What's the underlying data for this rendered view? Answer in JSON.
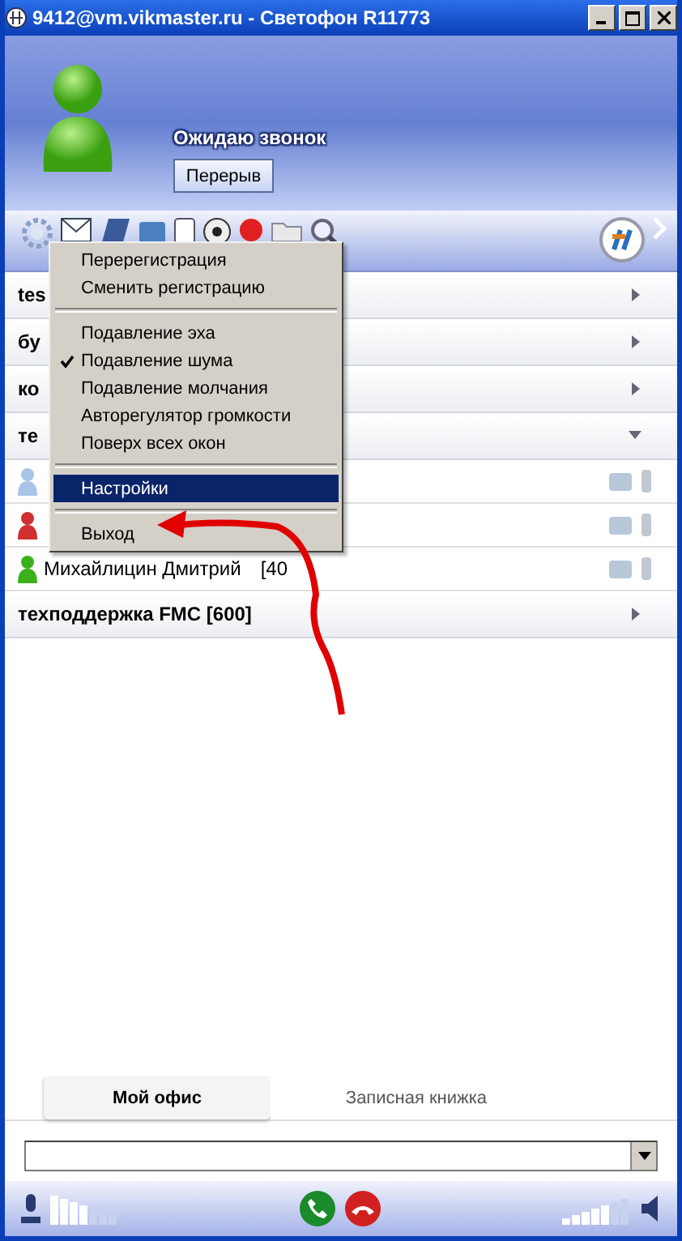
{
  "window": {
    "title": "9412@vm.vikmaster.ru - Светофон R11773"
  },
  "status": {
    "text": "Ожидаю звонок",
    "button": "Перерыв"
  },
  "groups": [
    {
      "label": "tes",
      "expanded": false
    },
    {
      "label": "бу",
      "expanded": false
    },
    {
      "label": "ко",
      "expanded": false
    },
    {
      "label": "те",
      "expanded": true,
      "contacts": [
        {
          "color": "#a8c4e8"
        },
        {
          "color": "#d03030"
        },
        {
          "name": "Михайлицин Дмитрий",
          "extension": "[40",
          "color": "#3cb01c"
        }
      ]
    },
    {
      "label": "техподдержка FMC  [600]",
      "expanded": false
    }
  ],
  "menu": [
    {
      "kind": "item",
      "label": "Перерегистрация",
      "checked": false,
      "selected": false
    },
    {
      "kind": "item",
      "label": "Сменить регистрацию",
      "checked": false,
      "selected": false
    },
    {
      "kind": "separator"
    },
    {
      "kind": "item",
      "label": "Подавление эха",
      "checked": false,
      "selected": false
    },
    {
      "kind": "item",
      "label": "Подавление шума",
      "checked": true,
      "selected": false
    },
    {
      "kind": "item",
      "label": "Подавление молчания",
      "checked": false,
      "selected": false
    },
    {
      "kind": "item",
      "label": "Авторегулятор громкости",
      "checked": false,
      "selected": false
    },
    {
      "kind": "item",
      "label": "Поверх всех окон",
      "checked": false,
      "selected": false
    },
    {
      "kind": "separator"
    },
    {
      "kind": "item",
      "label": "Настройки",
      "checked": false,
      "selected": true
    },
    {
      "kind": "separator"
    },
    {
      "kind": "item",
      "label": "Выход",
      "checked": false,
      "selected": false
    }
  ],
  "tabs": [
    {
      "label": "Мой офис",
      "selected": true
    },
    {
      "label": "Записная книжка",
      "selected": false
    }
  ]
}
